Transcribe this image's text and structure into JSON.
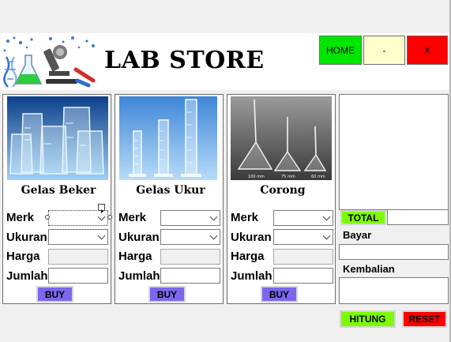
{
  "header": {
    "title": "LAB STORE",
    "home_label": "HOME",
    "minimize_label": "-",
    "close_label": "X"
  },
  "colors": {
    "home": "#00e600",
    "minimize": "#ffffcc",
    "close": "#ff0000",
    "buy": "#7b68ee",
    "total": "#7cfc00",
    "hitung": "#7cfc00",
    "reset": "#ff0000"
  },
  "products": [
    {
      "name": "Gelas Beker",
      "merk_label": "Merk",
      "ukuran_label": "Ukuran",
      "harga_label": "Harga",
      "jumlah_label": "Jumlah",
      "buy_label": "BUY"
    },
    {
      "name": "Gelas Ukur",
      "merk_label": "Merk",
      "ukuran_label": "Ukuran",
      "harga_label": "Harga",
      "jumlah_label": "Jumlah",
      "buy_label": "BUY"
    },
    {
      "name": "Corong",
      "merk_label": "Merk",
      "ukuran_label": "Ukuran",
      "harga_label": "Harga",
      "jumlah_label": "Jumlah",
      "buy_label": "BUY"
    }
  ],
  "corong_scale": {
    "a": "100 mm",
    "b": "75 mm",
    "c": "60 mm"
  },
  "summary": {
    "total_label": "TOTAL",
    "bayar_label": "Bayar",
    "kembalian_label": "Kembalian"
  },
  "actions": {
    "hitung_label": "HITUNG",
    "reset_label": "RESET"
  }
}
